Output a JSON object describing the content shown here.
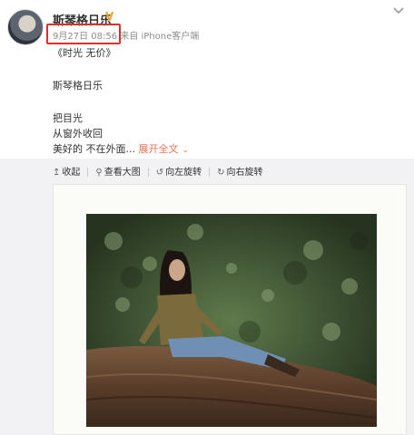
{
  "post": {
    "username": "斯琴格日乐",
    "verified_icon": "verified-v-icon",
    "date": "9月27日",
    "time": "08:56",
    "source": "来自 iPhone客户端",
    "text": {
      "title": "《时光 无价》",
      "name": "斯琴格日乐",
      "line1": "把目光",
      "line2": "从窗外收回",
      "line3": "美好的 不在外面...",
      "expand": "展开全文"
    }
  },
  "media_toolbar": {
    "collapse": "收起",
    "view_large": "查看大图",
    "rotate_left": "向左旋转",
    "rotate_right": "向右旋转"
  },
  "colors": {
    "highlight_box": "#d9312b",
    "expand_link": "#eb7350",
    "verified": "#f5a623"
  }
}
